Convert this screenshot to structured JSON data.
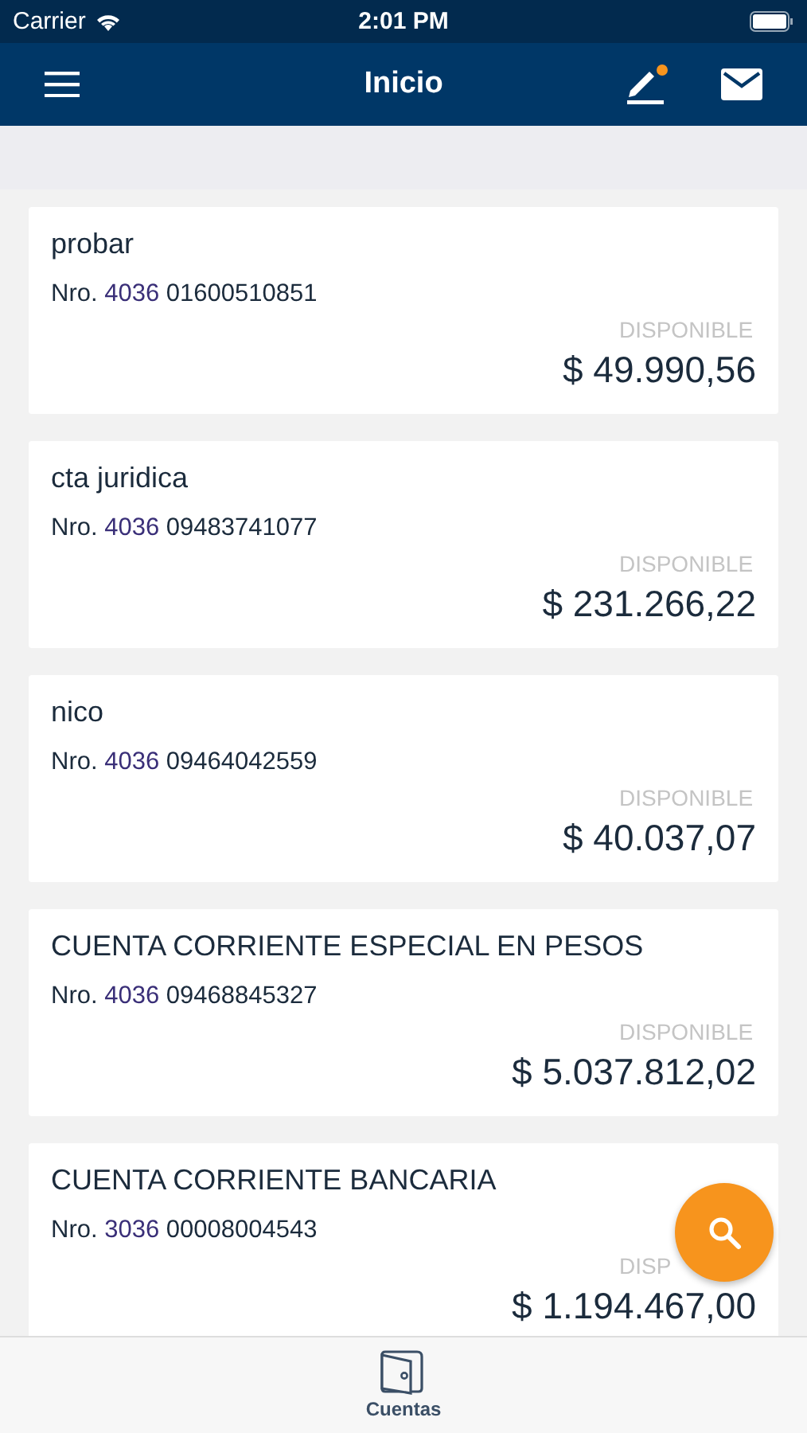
{
  "status_bar": {
    "carrier": "Carrier",
    "time": "2:01 PM"
  },
  "nav_bar": {
    "title": "Inicio",
    "notification_dot": true
  },
  "accounts": [
    {
      "name": "probar",
      "prefix": "Nro. ",
      "branch": "4036",
      "number": "01600510851",
      "balance_label": "DISPONIBLE",
      "balance": "$ 49.990,56"
    },
    {
      "name": "cta juridica",
      "prefix": "Nro. ",
      "branch": "4036",
      "number": "09483741077",
      "balance_label": "DISPONIBLE",
      "balance": "$ 231.266,22"
    },
    {
      "name": "nico",
      "prefix": "Nro. ",
      "branch": "4036",
      "number": "09464042559",
      "balance_label": "DISPONIBLE",
      "balance": "$ 40.037,07"
    },
    {
      "name": "CUENTA CORRIENTE ESPECIAL EN PESOS",
      "prefix": "Nro. ",
      "branch": "4036",
      "number": "09468845327",
      "balance_label": "DISPONIBLE",
      "balance": "$ 5.037.812,02"
    },
    {
      "name": "CUENTA CORRIENTE BANCARIA",
      "prefix": "Nro. ",
      "branch": "3036",
      "number": "00008004543",
      "balance_label": "DISP",
      "balance": "$ 1.194.467,00"
    }
  ],
  "tab_bar": [
    {
      "label": "Cuentas",
      "selected": true
    }
  ]
}
